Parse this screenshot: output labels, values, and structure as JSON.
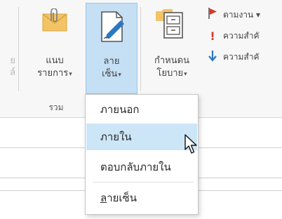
{
  "ribbon": {
    "left_partial_label": [
      "ย",
      "ล์"
    ],
    "attach_button": {
      "line1": "แนบ",
      "line2": "รายการ",
      "caret": "▾",
      "icon": "attach-envelope-icon"
    },
    "signature_button": {
      "line1": "ลาย",
      "line2": "เซ็น",
      "caret": "▾",
      "icon": "signature-pen-icon"
    },
    "policy_button": {
      "line1": "กำหนดน",
      "line2": "โยบาย",
      "caret": "▾",
      "icon": "cabinet-policy-icon"
    },
    "small_buttons": [
      {
        "label": "ตามงาน ▾",
        "icon": "flag-icon"
      },
      {
        "label": "ความสำคั",
        "icon": "high-importance-icon"
      },
      {
        "label": "ความสำคั",
        "icon": "low-importance-icon"
      }
    ],
    "group_label": "รวม"
  },
  "signature_menu": {
    "items": [
      {
        "label": "ภายนอก",
        "hovered": false
      },
      {
        "label": "ภายใน",
        "hovered": true
      },
      {
        "label": "ตอบกลับภายใน",
        "hovered": false
      }
    ],
    "footer_item": {
      "first_char": "ล",
      "rest": "ายเซ็น"
    }
  },
  "colors": {
    "accent_blue": "#2b78c2",
    "hover_bg": "#cde6f7",
    "selected_button_bg": "#c5dff4",
    "envelope": "#f3c466",
    "flag_red": "#d7372b"
  }
}
